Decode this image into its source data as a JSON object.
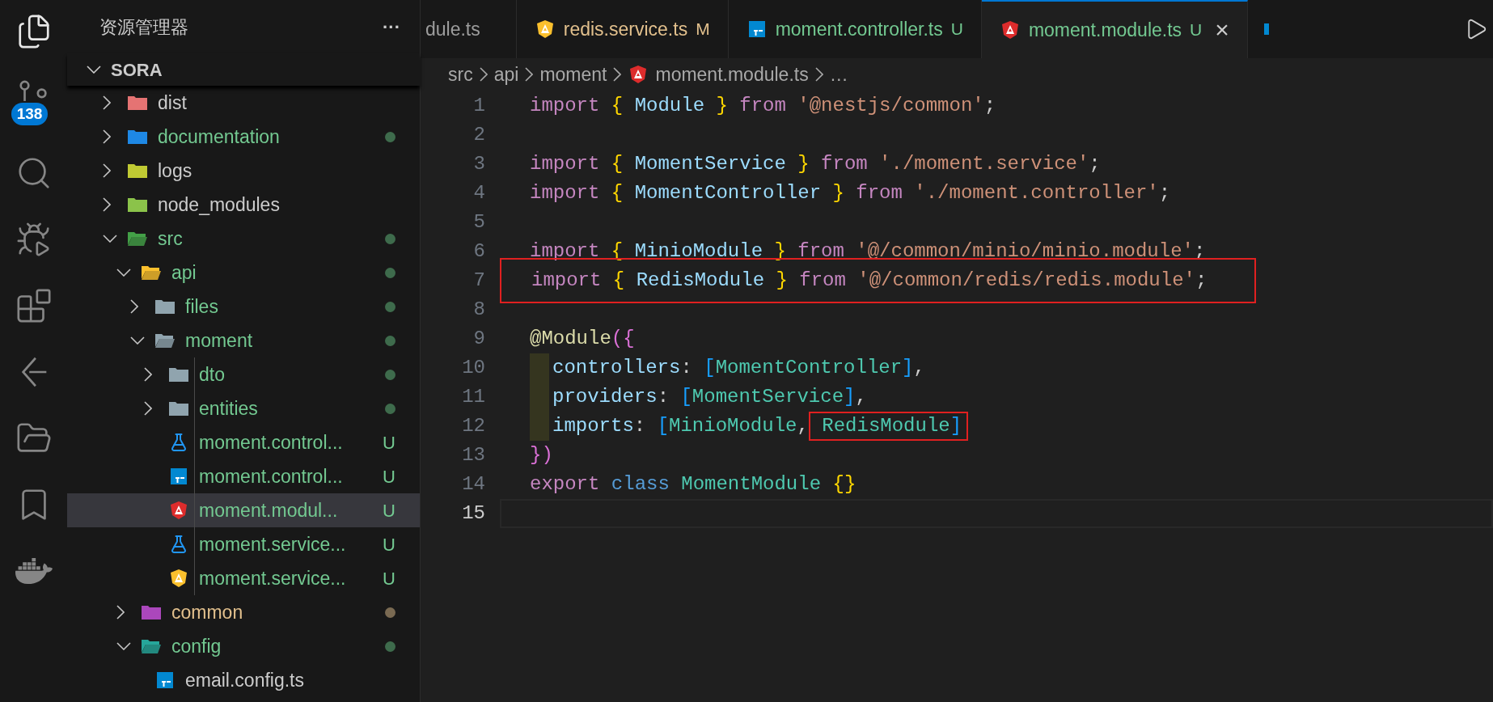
{
  "activity_bar": [
    {
      "kind": "explorer",
      "selected": true
    },
    {
      "kind": "source-control",
      "selected": false,
      "badge": "138"
    },
    {
      "kind": "search",
      "selected": false
    },
    {
      "kind": "run-debug",
      "selected": false
    },
    {
      "kind": "extensions",
      "selected": false
    },
    {
      "kind": "remote",
      "selected": false
    },
    {
      "kind": "folders",
      "selected": false
    },
    {
      "kind": "bookmarks",
      "selected": false
    },
    {
      "kind": "docker",
      "selected": false
    }
  ],
  "sidebar": {
    "title": "资源管理器",
    "more": "···",
    "section": {
      "title": "SORA",
      "expanded": true
    },
    "tree": [
      {
        "name": "dist",
        "kind": "folder",
        "color": "#e57373",
        "expanded": false,
        "untracked": false,
        "modified": false,
        "dot": false,
        "selected": false
      },
      {
        "name": "documentation",
        "kind": "folder",
        "color": "#1e88e5",
        "expanded": false,
        "untracked": true,
        "modified": false,
        "dot": true,
        "selected": false
      },
      {
        "name": "logs",
        "kind": "folder",
        "color": "#c0ca33",
        "expanded": false,
        "untracked": false,
        "modified": false,
        "dot": false,
        "selected": false
      },
      {
        "name": "node_modules",
        "kind": "folder",
        "color": "#8bc34a",
        "expanded": false,
        "untracked": false,
        "modified": false,
        "dot": false,
        "selected": false
      },
      {
        "name": "src",
        "kind": "folder",
        "color": "#43a047",
        "expanded": true,
        "untracked": true,
        "modified": false,
        "dot": true,
        "selected": false,
        "children": [
          {
            "name": "api",
            "kind": "folder",
            "color": "#fbc02d",
            "expanded": true,
            "untracked": true,
            "modified": false,
            "dot": true,
            "selected": false,
            "children": [
              {
                "name": "files",
                "kind": "folder",
                "color": "#90a4ae",
                "expanded": false,
                "untracked": true,
                "modified": false,
                "dot": true,
                "selected": false
              },
              {
                "name": "moment",
                "kind": "folder",
                "color": "#90a4ae",
                "expanded": true,
                "untracked": true,
                "modified": false,
                "dot": true,
                "selected": false,
                "children": [
                  {
                    "name": "dto",
                    "kind": "folder",
                    "color": "#90a4ae",
                    "expanded": false,
                    "untracked": true,
                    "modified": false,
                    "dot": true,
                    "selected": false
                  },
                  {
                    "name": "entities",
                    "kind": "folder",
                    "color": "#90a4ae",
                    "expanded": false,
                    "untracked": true,
                    "modified": false,
                    "dot": true,
                    "selected": false
                  },
                  {
                    "name": "moment.control...",
                    "kind": "spec-file",
                    "untracked": true,
                    "modified": false,
                    "status": "U",
                    "selected": false
                  },
                  {
                    "name": "moment.control...",
                    "kind": "ts-file",
                    "untracked": true,
                    "modified": false,
                    "status": "U",
                    "selected": false
                  },
                  {
                    "name": "moment.modul...",
                    "kind": "module-file",
                    "untracked": true,
                    "modified": false,
                    "status": "U",
                    "selected": true
                  },
                  {
                    "name": "moment.service...",
                    "kind": "spec-file",
                    "untracked": true,
                    "modified": false,
                    "status": "U",
                    "selected": false
                  },
                  {
                    "name": "moment.service...",
                    "kind": "service-file",
                    "untracked": true,
                    "modified": false,
                    "status": "U",
                    "selected": false
                  }
                ]
              }
            ]
          },
          {
            "name": "common",
            "kind": "folder",
            "color": "#ab47bc",
            "expanded": false,
            "modified": true,
            "dot": true,
            "selected": false
          },
          {
            "name": "config",
            "kind": "folder",
            "color": "#26a69a",
            "expanded": true,
            "untracked": true,
            "modified": false,
            "dot": true,
            "selected": false,
            "children": [
              {
                "name": "email.config.ts",
                "kind": "ts-file",
                "untracked": false,
                "modified": false,
                "selected": false
              }
            ]
          }
        ]
      }
    ]
  },
  "tabs": [
    {
      "label": "dule.ts",
      "untracked": false,
      "modified": false,
      "selected": false
    },
    {
      "label": "redis.service.ts",
      "kind": "service-file",
      "modified": true,
      "badge": "M",
      "selected": false
    },
    {
      "label": "moment.controller.ts",
      "kind": "ts-file",
      "untracked": true,
      "modified": false,
      "badge": "U",
      "selected": false
    },
    {
      "label": "moment.module.ts",
      "kind": "module-file",
      "untracked": true,
      "modified": false,
      "badge": "U",
      "selected": true,
      "close": "×"
    }
  ],
  "breadcrumb": [
    {
      "label": "src"
    },
    {
      "label": "api"
    },
    {
      "label": "moment"
    },
    {
      "label": "moment.module.ts",
      "kind": "module-file"
    },
    {
      "label": "…"
    }
  ],
  "code": [
    {
      "number": "1",
      "tokens": [
        {
          "kind": "kw",
          "text": "import "
        },
        {
          "kind": "brace",
          "text": "{"
        },
        {
          "kind": "id",
          "text": " Module "
        },
        {
          "kind": "brace",
          "text": "}"
        },
        {
          "kind": "kw",
          "text": " from "
        },
        {
          "kind": "str",
          "text": "'@nestjs/common'"
        },
        {
          "kind": "p",
          "text": ";"
        }
      ]
    },
    {
      "number": "2"
    },
    {
      "number": "3",
      "tokens": [
        {
          "kind": "kw",
          "text": "import "
        },
        {
          "kind": "brace",
          "text": "{"
        },
        {
          "kind": "id",
          "text": " MomentService "
        },
        {
          "kind": "brace",
          "text": "}"
        },
        {
          "kind": "kw",
          "text": " from "
        },
        {
          "kind": "str",
          "text": "'./moment.service'"
        },
        {
          "kind": "p",
          "text": ";"
        }
      ]
    },
    {
      "number": "4",
      "tokens": [
        {
          "kind": "kw",
          "text": "import "
        },
        {
          "kind": "brace",
          "text": "{"
        },
        {
          "kind": "id",
          "text": " MomentController "
        },
        {
          "kind": "brace",
          "text": "}"
        },
        {
          "kind": "kw",
          "text": " from "
        },
        {
          "kind": "str",
          "text": "'./moment.controller'"
        },
        {
          "kind": "p",
          "text": ";"
        }
      ]
    },
    {
      "number": "5"
    },
    {
      "number": "6",
      "tokens": [
        {
          "kind": "kw",
          "text": "import "
        },
        {
          "kind": "brace",
          "text": "{"
        },
        {
          "kind": "id",
          "text": " MinioModule "
        },
        {
          "kind": "brace",
          "text": "}"
        },
        {
          "kind": "kw",
          "text": " from "
        },
        {
          "kind": "str",
          "text": "'@/common/minio/minio.module'"
        },
        {
          "kind": "p",
          "text": ";"
        }
      ]
    },
    {
      "number": "7",
      "highlighted": true,
      "tokens": [
        {
          "kind": "kw",
          "text": "import "
        },
        {
          "kind": "brace",
          "text": "{"
        },
        {
          "kind": "id",
          "text": " RedisModule "
        },
        {
          "kind": "brace",
          "text": "}"
        },
        {
          "kind": "kw",
          "text": " from "
        },
        {
          "kind": "str",
          "text": "'@/common/redis/redis.module'"
        },
        {
          "kind": "p",
          "text": ";"
        }
      ]
    },
    {
      "number": "8"
    },
    {
      "number": "9",
      "tokens": [
        {
          "kind": "dec",
          "text": "@Module"
        },
        {
          "kind": "paren",
          "text": "({"
        }
      ]
    },
    {
      "number": "10",
      "indent": true,
      "tokens": [
        {
          "kind": "id",
          "text": "controllers"
        },
        {
          "kind": "p",
          "text": ": "
        },
        {
          "kind": "bracket",
          "text": "["
        },
        {
          "kind": "type",
          "text": "MomentController"
        },
        {
          "kind": "bracket",
          "text": "]"
        },
        {
          "kind": "p",
          "text": ","
        }
      ]
    },
    {
      "number": "11",
      "indent": true,
      "tokens": [
        {
          "kind": "id",
          "text": "providers"
        },
        {
          "kind": "p",
          "text": ": "
        },
        {
          "kind": "bracket",
          "text": "["
        },
        {
          "kind": "type",
          "text": "MomentService"
        },
        {
          "kind": "bracket",
          "text": "]"
        },
        {
          "kind": "p",
          "text": ","
        }
      ]
    },
    {
      "number": "12",
      "indent": true,
      "tokens": [
        {
          "kind": "id",
          "text": "imports"
        },
        {
          "kind": "p",
          "text": ": "
        },
        {
          "kind": "bracket",
          "text": "["
        },
        {
          "kind": "type",
          "text": "MinioModule"
        },
        {
          "kind": "p",
          "text": ","
        },
        {
          "kind": "type",
          "text": " RedisModule",
          "boxed": true
        },
        {
          "kind": "bracket",
          "text": "]",
          "boxed": true
        }
      ]
    },
    {
      "number": "13",
      "tokens": [
        {
          "kind": "paren",
          "text": "})"
        }
      ]
    },
    {
      "number": "14",
      "tokens": [
        {
          "kind": "kw",
          "text": "export "
        },
        {
          "kind": "storage",
          "text": "class "
        },
        {
          "kind": "type",
          "text": "MomentModule "
        },
        {
          "kind": "brace",
          "text": "{}"
        }
      ]
    },
    {
      "number": "15",
      "current": true
    }
  ]
}
